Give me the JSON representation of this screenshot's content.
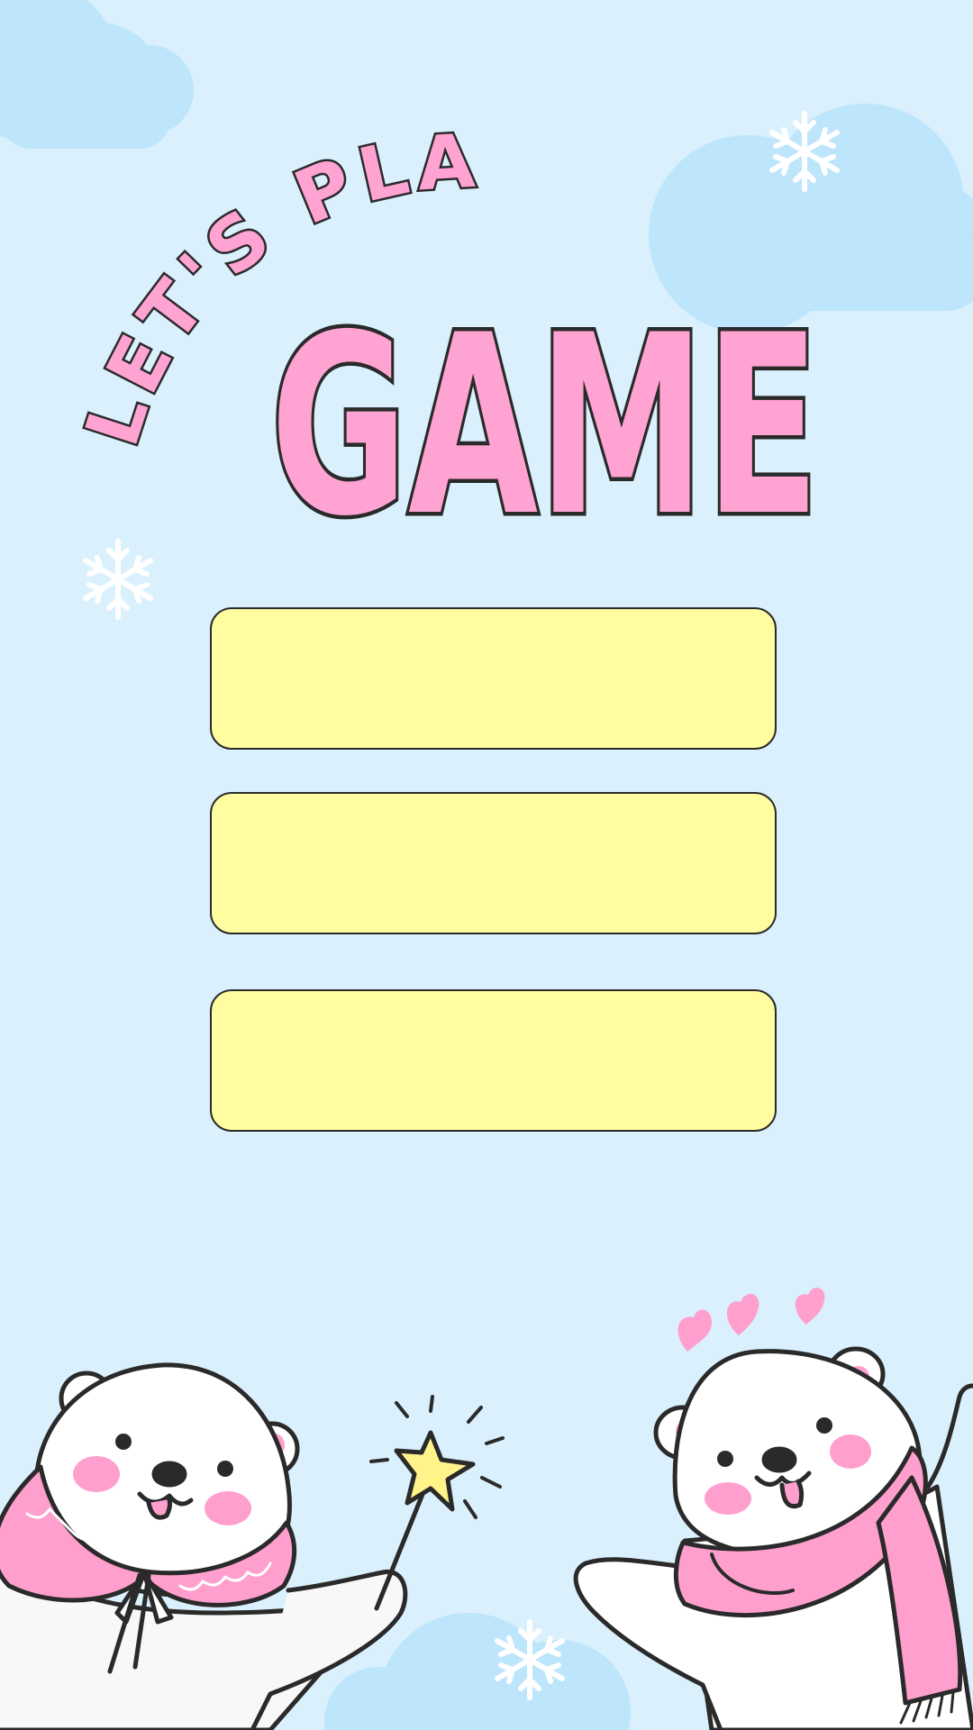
{
  "title": {
    "line1": "LET'S PLAY",
    "line2": "GAME"
  },
  "menu": {
    "buttons": [
      {
        "label": ""
      },
      {
        "label": ""
      },
      {
        "label": ""
      }
    ]
  },
  "colors": {
    "background": "#daf0fd",
    "cloud": "#bde5fb",
    "title_fill": "#ffa3d2",
    "outline": "#2a2a2a",
    "button_fill": "#fffd9f",
    "bear_white": "#ffffff",
    "accent_pink": "#ff9fcd",
    "star_yellow": "#fff38a"
  },
  "icons": [
    "snowflake-icon",
    "heart-icon",
    "star-wand-icon",
    "cloud-icon"
  ]
}
